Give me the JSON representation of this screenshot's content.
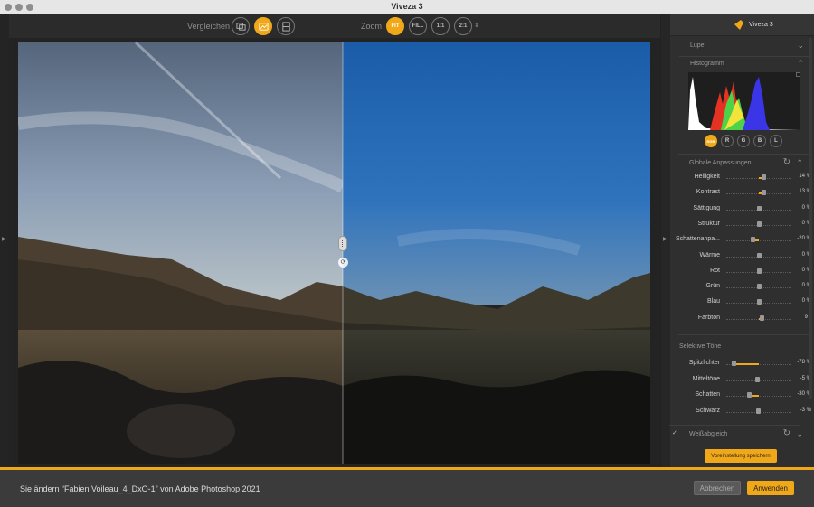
{
  "window": {
    "title": "Viveza 3"
  },
  "toolbar": {
    "compare_label": "Vergleichen",
    "zoom_label": "Zoom",
    "zoom_options": [
      {
        "label": "FIT",
        "active": true
      },
      {
        "label": "FILL",
        "active": false
      },
      {
        "label": "1:1",
        "active": false
      },
      {
        "label": "2:1",
        "active": false
      }
    ],
    "stepper_glyph": "⇕"
  },
  "panel": {
    "brand_name": "Viveza 3",
    "loupe_label": "Lupe",
    "histogram_label": "Histogramm",
    "channels": [
      {
        "label": "RGB",
        "active": true
      },
      {
        "label": "R",
        "active": false
      },
      {
        "label": "G",
        "active": false
      },
      {
        "label": "B",
        "active": false
      },
      {
        "label": "L",
        "active": false
      }
    ],
    "global_label": "Globale Anpassungen",
    "global_sliders": [
      {
        "name": "Helligkeit",
        "value": "14 %",
        "level": 14
      },
      {
        "name": "Kontrast",
        "value": "13 %",
        "level": 13
      },
      {
        "name": "Sättigung",
        "value": "0 %",
        "level": 0
      },
      {
        "name": "Struktur",
        "value": "0 %",
        "level": 0
      },
      {
        "name": "Schattenanpa...",
        "value": "-20 %",
        "level": -20
      },
      {
        "name": "Wärme",
        "value": "0 %",
        "level": 0
      },
      {
        "name": "Rot",
        "value": "0 %",
        "level": 0
      },
      {
        "name": "Grün",
        "value": "0 %",
        "level": 0
      },
      {
        "name": "Blau",
        "value": "0 %",
        "level": 0
      },
      {
        "name": "Farbton",
        "value": "9 °",
        "level": 9
      }
    ],
    "selective_label": "Selektive Töne",
    "selective_sliders": [
      {
        "name": "Spitzlichter",
        "value": "-78 %",
        "level": -78
      },
      {
        "name": "Mitteltöne",
        "value": "-5 %",
        "level": -5
      },
      {
        "name": "Schatten",
        "value": "-30 %",
        "level": -30
      },
      {
        "name": "Schwarz",
        "value": "-3 %",
        "level": -3
      }
    ],
    "whitebalance_label": "Weißabgleich",
    "checkmark_glyph": "✓",
    "save_preset_label": "Voreinstellung speichern"
  },
  "bottom": {
    "message": "Sie ändern “Fabien Voileau_4_DxO-1” von Adobe Photoshop 2021",
    "cancel_label": "Abbrechen",
    "apply_label": "Anwenden"
  },
  "colors": {
    "accent": "#f0a818",
    "panel_bg": "#2f2f2f",
    "bottom_bg": "#3b3b3b"
  }
}
